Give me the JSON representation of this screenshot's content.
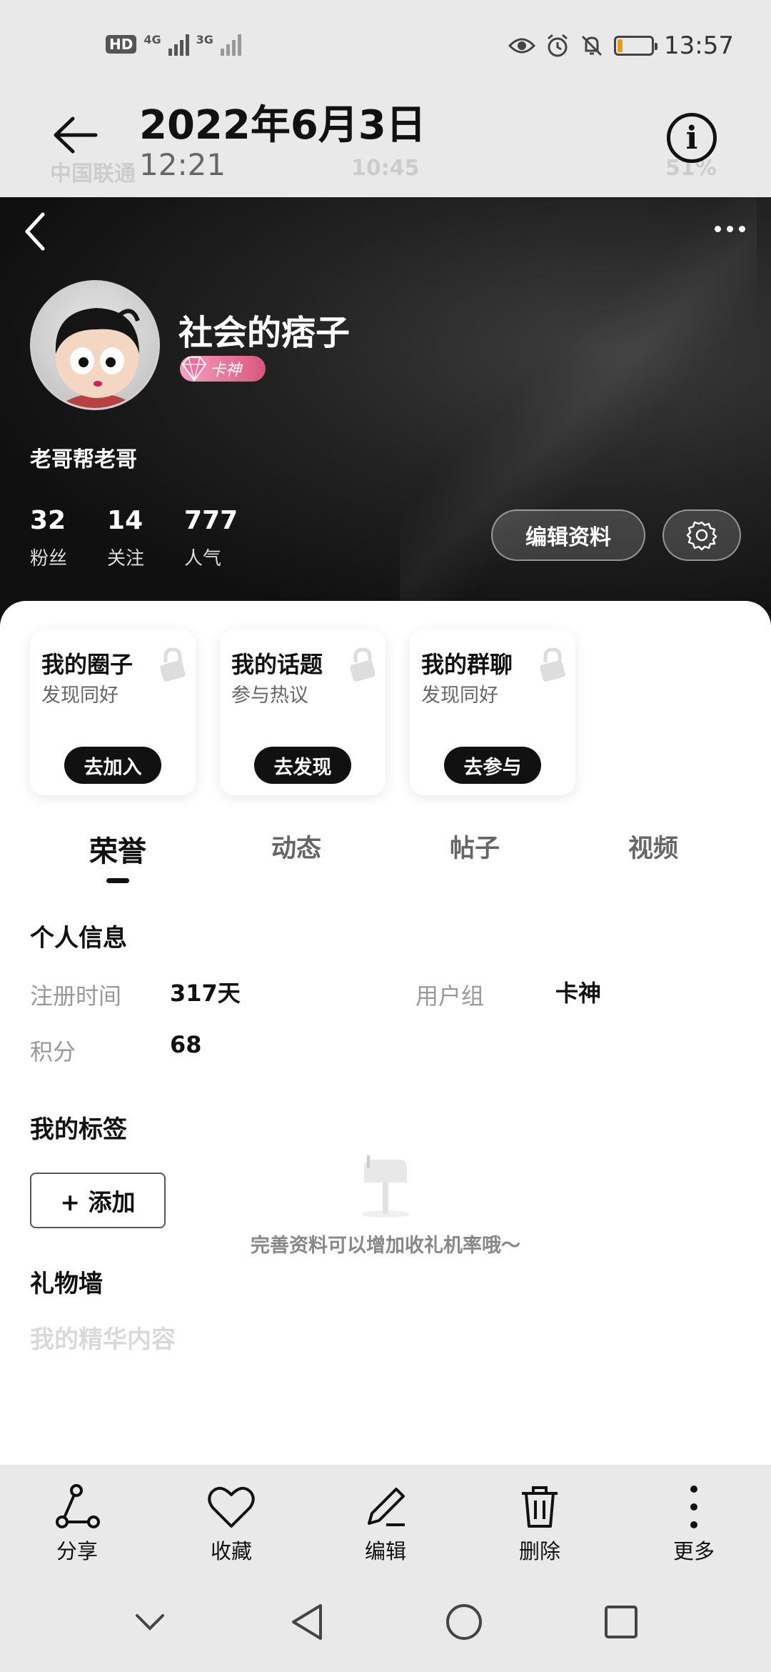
{
  "status_bar": {
    "hd": "HD",
    "net1": "4G",
    "net2": "3G",
    "time": "13:57",
    "battery_percent": 15
  },
  "viewer": {
    "date": "2022年6月3日",
    "time": "12:21",
    "info_glyph": "i"
  },
  "ghost_status": {
    "carrier": "中国联通",
    "time": "10:45",
    "battery": "51%"
  },
  "profile": {
    "name": "社会的痞子",
    "badge": "卡神",
    "bio": "老哥帮老哥",
    "stats": [
      {
        "num": "32",
        "label": "粉丝"
      },
      {
        "num": "14",
        "label": "关注"
      },
      {
        "num": "777",
        "label": "人气"
      }
    ],
    "edit_label": "编辑资料"
  },
  "cards": [
    {
      "title": "我的圈子",
      "subtitle": "发现同好",
      "button": "去加入"
    },
    {
      "title": "我的话题",
      "subtitle": "参与热议",
      "button": "去发现"
    },
    {
      "title": "我的群聊",
      "subtitle": "发现同好",
      "button": "去参与"
    }
  ],
  "tabs": [
    {
      "label": "荣誉",
      "active": true
    },
    {
      "label": "动态",
      "active": false
    },
    {
      "label": "帖子",
      "active": false
    },
    {
      "label": "视频",
      "active": false
    }
  ],
  "personal_info": {
    "title": "个人信息",
    "reg_label": "注册时间",
    "reg_value": "317天",
    "group_label": "用户组",
    "group_value": "卡神",
    "points_label": "积分",
    "points_value": "68"
  },
  "tags": {
    "title": "我的标签",
    "add_label": "+ 添加"
  },
  "gift_wall": {
    "title": "礼物墙",
    "empty_tip": "完善资料可以增加收礼机率哦～"
  },
  "ghost_section": "我的精华内容",
  "actions": [
    {
      "label": "分享",
      "icon": "share-icon"
    },
    {
      "label": "收藏",
      "icon": "heart-icon"
    },
    {
      "label": "编辑",
      "icon": "edit-icon"
    },
    {
      "label": "删除",
      "icon": "trash-icon"
    },
    {
      "label": "更多",
      "icon": "more-icon"
    }
  ]
}
